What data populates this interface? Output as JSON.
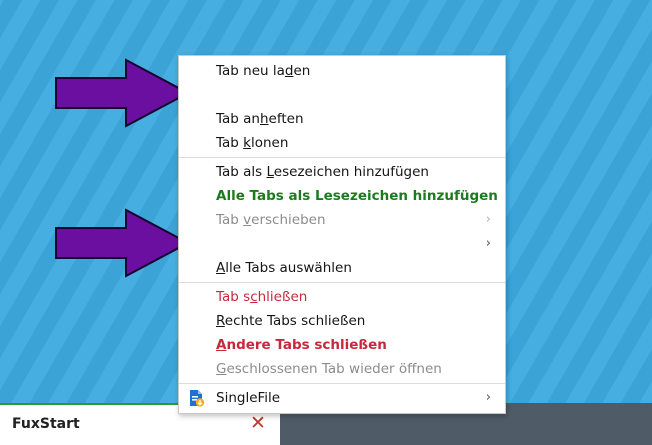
{
  "colors": {
    "desktop": "#3ea7d9",
    "arrow_fill": "#6a0fa0",
    "green_item": "#1e7a1e",
    "red_item": "#c8283c",
    "disabled_item": "#8c8c8c",
    "tab_indicator": "#2e9a2e",
    "close_icon": "#c0392b"
  },
  "context_menu": {
    "reload_tab": [
      "Tab neu la",
      "d",
      "en"
    ],
    "pin_tab": [
      "Tab an",
      "h",
      "eften"
    ],
    "duplicate_tab": [
      "Tab ",
      "k",
      "lonen"
    ],
    "bookmark_tab": [
      "Tab als ",
      "L",
      "esezeichen hinzufügen"
    ],
    "bookmark_all_tabs": "Alle Tabs als Lesezeichen hinzufügen",
    "move_tab": [
      "Tab ",
      "v",
      "erschieben"
    ],
    "select_all_tabs": [
      "",
      "A",
      "lle Tabs auswählen"
    ],
    "close_tab": [
      "Tab s",
      "c",
      "hließen"
    ],
    "close_tabs_right": [
      "",
      "R",
      "echte Tabs schließen"
    ],
    "close_other_tabs": [
      "",
      "A",
      "ndere Tabs schließen"
    ],
    "reopen_closed_tab": [
      "",
      "G",
      "eschlossenen Tab wieder öffnen"
    ],
    "singlefile": "SingleFile",
    "submenu_glyph": "›"
  },
  "tabbar": {
    "active_tab_title": "FuxStart",
    "close_glyph": "✕"
  },
  "icons": {
    "arrow_top": "purple-arrow-icon",
    "arrow_bottom": "purple-arrow-icon",
    "singlefile": "singlefile-icon"
  }
}
